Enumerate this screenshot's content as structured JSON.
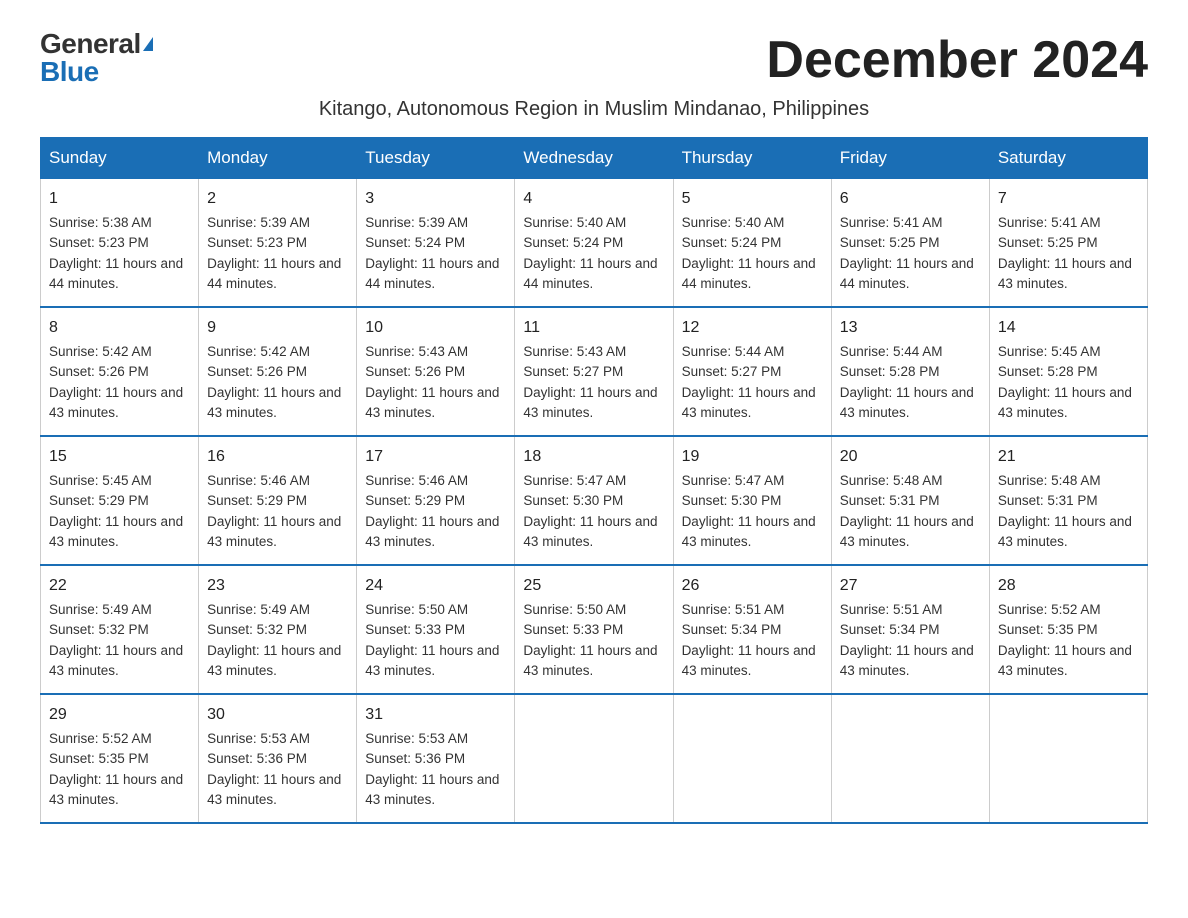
{
  "logo": {
    "general": "General",
    "blue": "Blue"
  },
  "title": "December 2024",
  "subtitle": "Kitango, Autonomous Region in Muslim Mindanao, Philippines",
  "days_of_week": [
    "Sunday",
    "Monday",
    "Tuesday",
    "Wednesday",
    "Thursday",
    "Friday",
    "Saturday"
  ],
  "weeks": [
    [
      {
        "day": "1",
        "sunrise": "5:38 AM",
        "sunset": "5:23 PM",
        "daylight": "11 hours and 44 minutes."
      },
      {
        "day": "2",
        "sunrise": "5:39 AM",
        "sunset": "5:23 PM",
        "daylight": "11 hours and 44 minutes."
      },
      {
        "day": "3",
        "sunrise": "5:39 AM",
        "sunset": "5:24 PM",
        "daylight": "11 hours and 44 minutes."
      },
      {
        "day": "4",
        "sunrise": "5:40 AM",
        "sunset": "5:24 PM",
        "daylight": "11 hours and 44 minutes."
      },
      {
        "day": "5",
        "sunrise": "5:40 AM",
        "sunset": "5:24 PM",
        "daylight": "11 hours and 44 minutes."
      },
      {
        "day": "6",
        "sunrise": "5:41 AM",
        "sunset": "5:25 PM",
        "daylight": "11 hours and 44 minutes."
      },
      {
        "day": "7",
        "sunrise": "5:41 AM",
        "sunset": "5:25 PM",
        "daylight": "11 hours and 43 minutes."
      }
    ],
    [
      {
        "day": "8",
        "sunrise": "5:42 AM",
        "sunset": "5:26 PM",
        "daylight": "11 hours and 43 minutes."
      },
      {
        "day": "9",
        "sunrise": "5:42 AM",
        "sunset": "5:26 PM",
        "daylight": "11 hours and 43 minutes."
      },
      {
        "day": "10",
        "sunrise": "5:43 AM",
        "sunset": "5:26 PM",
        "daylight": "11 hours and 43 minutes."
      },
      {
        "day": "11",
        "sunrise": "5:43 AM",
        "sunset": "5:27 PM",
        "daylight": "11 hours and 43 minutes."
      },
      {
        "day": "12",
        "sunrise": "5:44 AM",
        "sunset": "5:27 PM",
        "daylight": "11 hours and 43 minutes."
      },
      {
        "day": "13",
        "sunrise": "5:44 AM",
        "sunset": "5:28 PM",
        "daylight": "11 hours and 43 minutes."
      },
      {
        "day": "14",
        "sunrise": "5:45 AM",
        "sunset": "5:28 PM",
        "daylight": "11 hours and 43 minutes."
      }
    ],
    [
      {
        "day": "15",
        "sunrise": "5:45 AM",
        "sunset": "5:29 PM",
        "daylight": "11 hours and 43 minutes."
      },
      {
        "day": "16",
        "sunrise": "5:46 AM",
        "sunset": "5:29 PM",
        "daylight": "11 hours and 43 minutes."
      },
      {
        "day": "17",
        "sunrise": "5:46 AM",
        "sunset": "5:29 PM",
        "daylight": "11 hours and 43 minutes."
      },
      {
        "day": "18",
        "sunrise": "5:47 AM",
        "sunset": "5:30 PM",
        "daylight": "11 hours and 43 minutes."
      },
      {
        "day": "19",
        "sunrise": "5:47 AM",
        "sunset": "5:30 PM",
        "daylight": "11 hours and 43 minutes."
      },
      {
        "day": "20",
        "sunrise": "5:48 AM",
        "sunset": "5:31 PM",
        "daylight": "11 hours and 43 minutes."
      },
      {
        "day": "21",
        "sunrise": "5:48 AM",
        "sunset": "5:31 PM",
        "daylight": "11 hours and 43 minutes."
      }
    ],
    [
      {
        "day": "22",
        "sunrise": "5:49 AM",
        "sunset": "5:32 PM",
        "daylight": "11 hours and 43 minutes."
      },
      {
        "day": "23",
        "sunrise": "5:49 AM",
        "sunset": "5:32 PM",
        "daylight": "11 hours and 43 minutes."
      },
      {
        "day": "24",
        "sunrise": "5:50 AM",
        "sunset": "5:33 PM",
        "daylight": "11 hours and 43 minutes."
      },
      {
        "day": "25",
        "sunrise": "5:50 AM",
        "sunset": "5:33 PM",
        "daylight": "11 hours and 43 minutes."
      },
      {
        "day": "26",
        "sunrise": "5:51 AM",
        "sunset": "5:34 PM",
        "daylight": "11 hours and 43 minutes."
      },
      {
        "day": "27",
        "sunrise": "5:51 AM",
        "sunset": "5:34 PM",
        "daylight": "11 hours and 43 minutes."
      },
      {
        "day": "28",
        "sunrise": "5:52 AM",
        "sunset": "5:35 PM",
        "daylight": "11 hours and 43 minutes."
      }
    ],
    [
      {
        "day": "29",
        "sunrise": "5:52 AM",
        "sunset": "5:35 PM",
        "daylight": "11 hours and 43 minutes."
      },
      {
        "day": "30",
        "sunrise": "5:53 AM",
        "sunset": "5:36 PM",
        "daylight": "11 hours and 43 minutes."
      },
      {
        "day": "31",
        "sunrise": "5:53 AM",
        "sunset": "5:36 PM",
        "daylight": "11 hours and 43 minutes."
      },
      null,
      null,
      null,
      null
    ]
  ]
}
